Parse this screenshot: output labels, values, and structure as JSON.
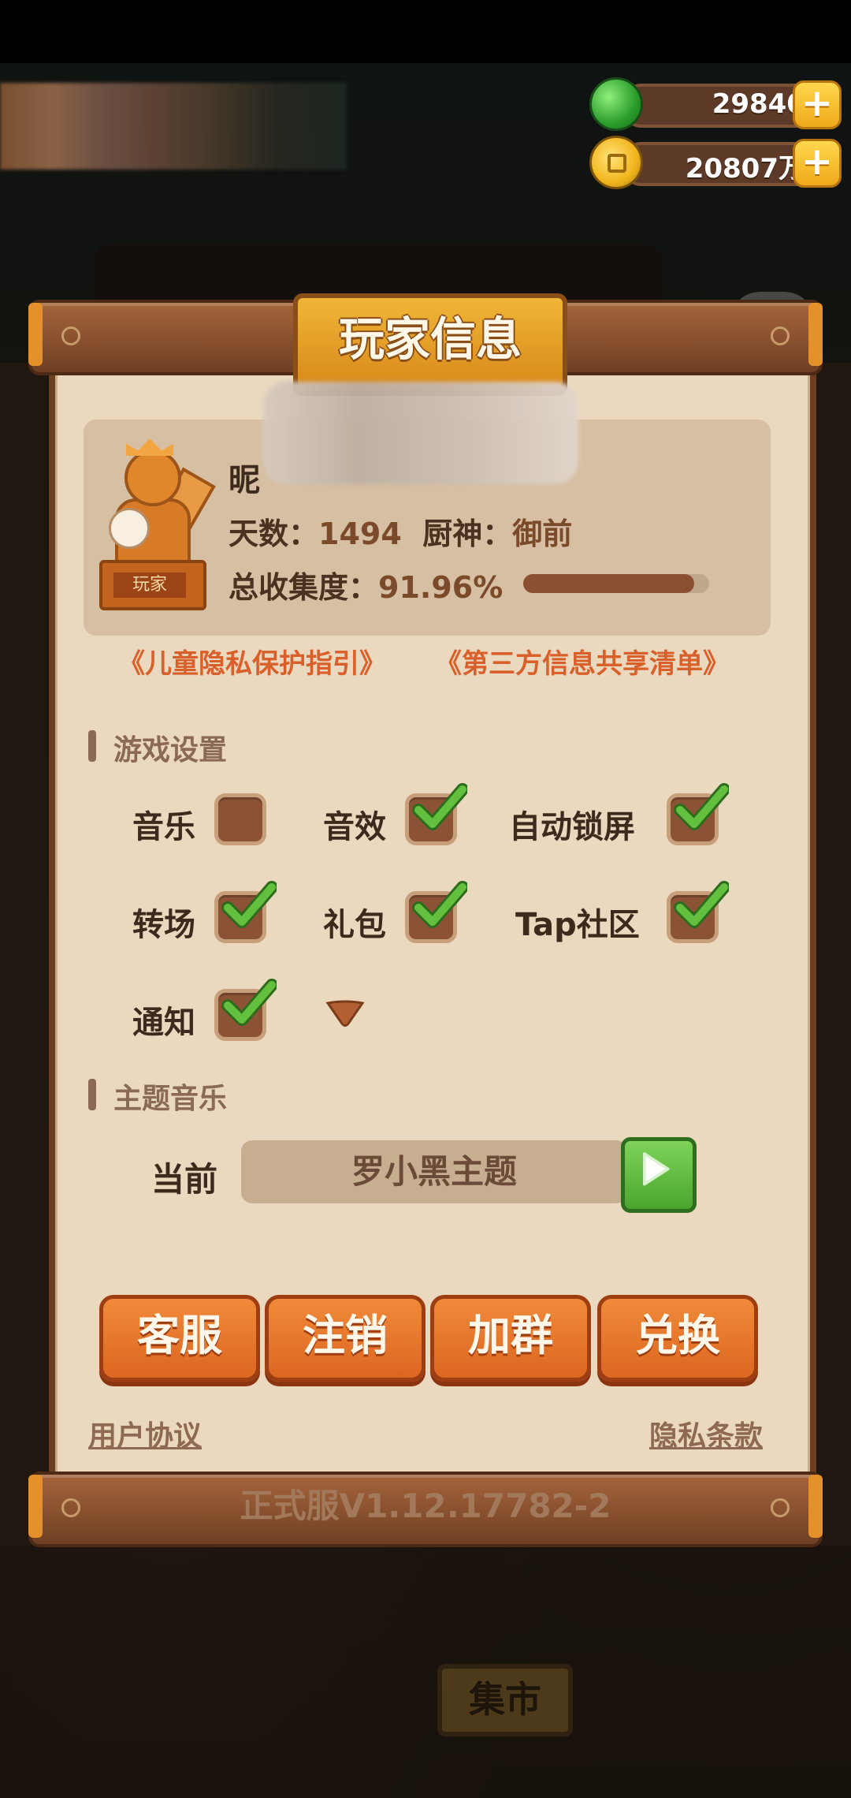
{
  "currency": {
    "jade_value": "29840",
    "coin_value": "20807万",
    "plus_label": "+"
  },
  "dialog": {
    "title": "玩家信息",
    "profile": {
      "nickname_prefix": "昵",
      "trophy_label": "玩家",
      "days_label": "天数：",
      "days_value": "1494",
      "chef_label": "厨神：",
      "chef_value": "御前",
      "collection_label": "总收集度：",
      "collection_value": "91.96%",
      "collection_fraction": 0.9196
    },
    "links": {
      "child_privacy": "《儿童隐私保护指引》",
      "third_party": "《第三方信息共享清单》"
    },
    "game_settings": {
      "section_title": "游戏设置",
      "items": [
        {
          "label": "音乐",
          "checked": false
        },
        {
          "label": "音效",
          "checked": true
        },
        {
          "label": "自动锁屏",
          "checked": true
        },
        {
          "label": "转场",
          "checked": true
        },
        {
          "label": "礼包",
          "checked": true
        },
        {
          "label": "Tap社区",
          "checked": true
        },
        {
          "label": "通知",
          "checked": true
        }
      ]
    },
    "theme_music": {
      "section_title": "主题音乐",
      "current_label": "当前",
      "current_theme": "罗小黑主题"
    },
    "buttons": {
      "customer_service": "客服",
      "deregister": "注销",
      "join_group": "加群",
      "redeem": "兑换"
    },
    "footer": {
      "user_agreement": "用户协议",
      "privacy_policy": "隐私条款"
    },
    "version": "正式服V1.12.17782-2"
  },
  "background": {
    "market_sign": "集市"
  },
  "colors": {
    "check_green": "#63c03e",
    "button_orange": "#e8722b",
    "link_orange": "#d9602a"
  }
}
